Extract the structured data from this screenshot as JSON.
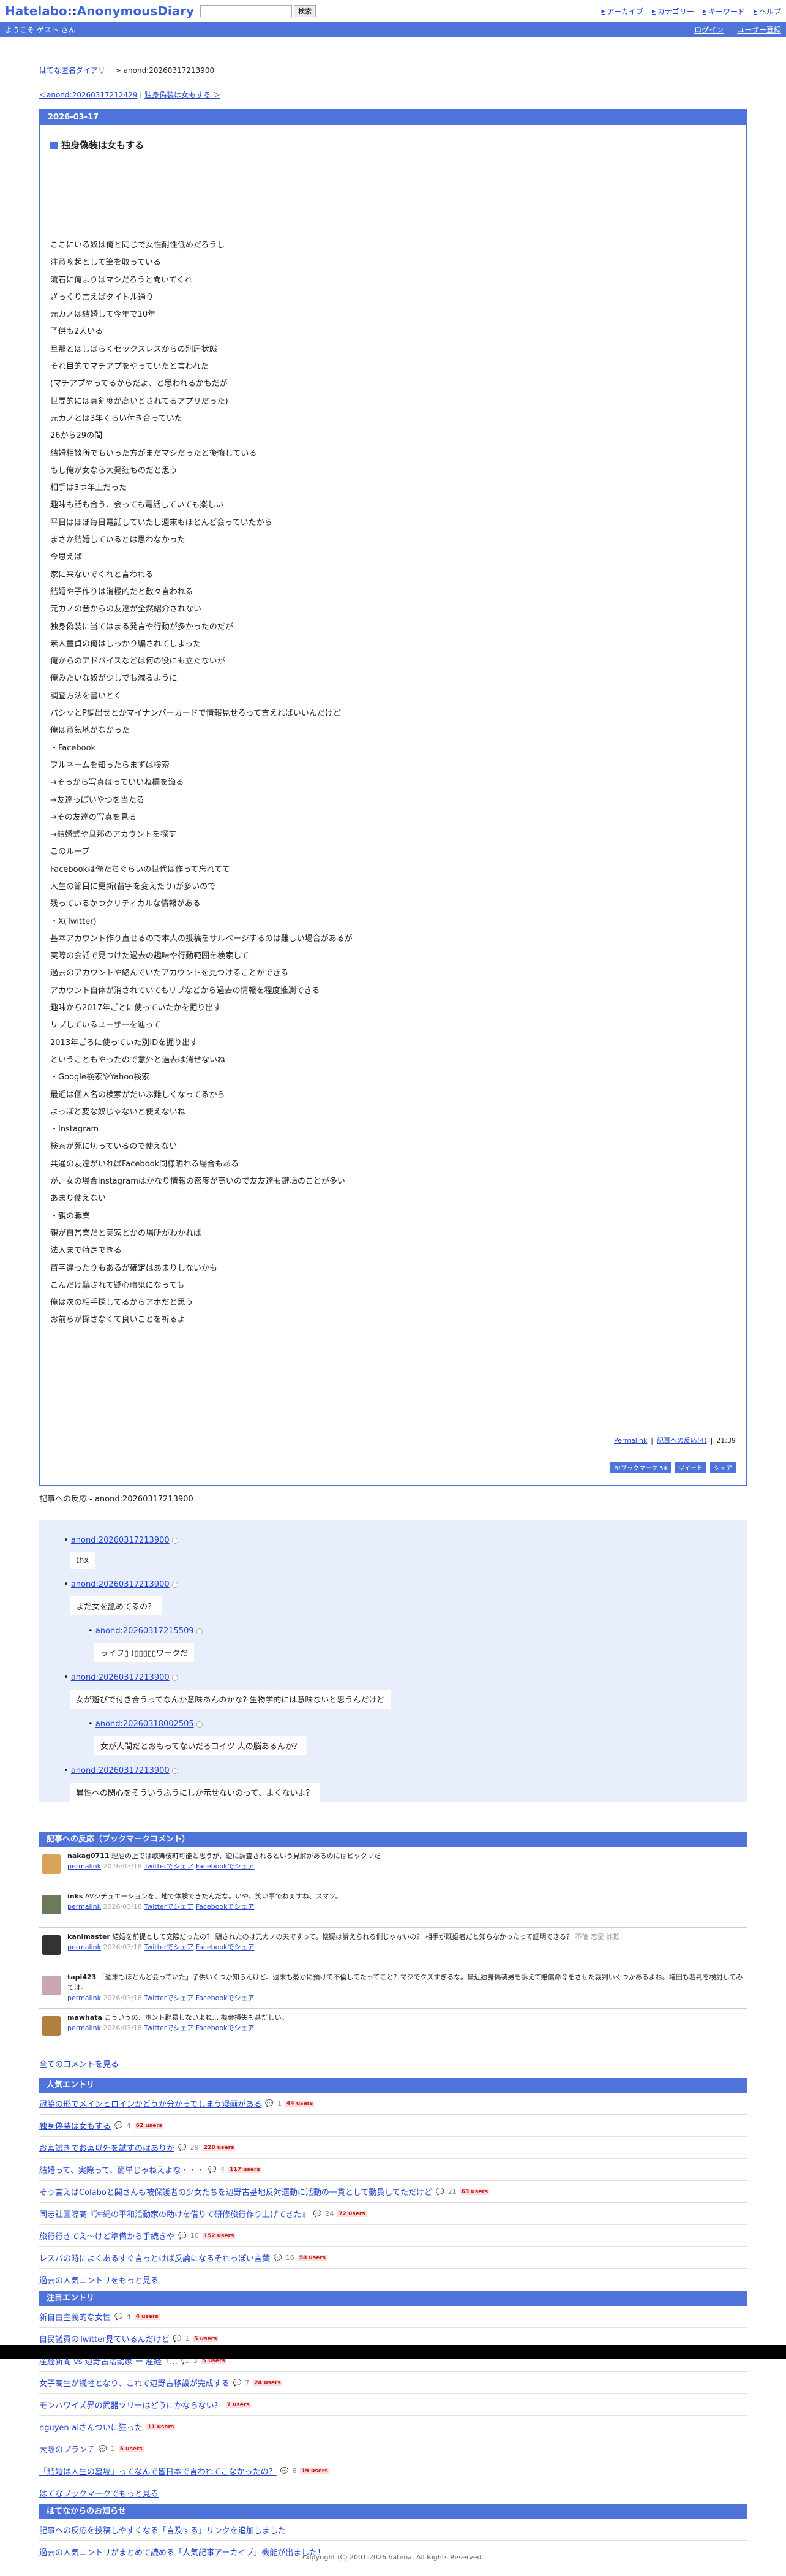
{
  "header": {
    "logo_left": "Hatelabo",
    "logo_sep": "::",
    "logo_right": "AnonymousDiary",
    "search_button": "検索",
    "nav": [
      "アーカイブ",
      "カテゴリー",
      "キーワード",
      "ヘルプ"
    ]
  },
  "bar": {
    "welcome": "ようこそ ゲスト さん",
    "login": "ログイン",
    "register": "ユーザー登録"
  },
  "crumb": {
    "home": "はてな匿名ダイアリー",
    "sep": " > ",
    "current": "anond:20260317213900"
  },
  "prevnext": {
    "prev": "＜anond:20260317212429",
    "sep": " | ",
    "next": "独身偽装は女もする ＞"
  },
  "article": {
    "date": "2026-03-17",
    "title": "独身偽装は女もする",
    "lines": [
      "ここにいる奴は俺と同じで女性耐性低めだろうし",
      "注意喚起として筆を取っている",
      "流石に俺よりはマシだろうと聞いてくれ",
      "ざっくり言えばタイトル通り",
      "元カノは結婚して今年で10年",
      "子供も2人いる",
      "旦那とはしばらくセックスレスからの別居状態",
      "それ目的でマチアプをやっていたと言われた",
      "(マチアプやってるからだよ、と思われるかもだが",
      "世間的には真剣度が高いとされてるアプリだった)",
      "元カノとは3年くらい付き合っていた",
      "26から29の間",
      "結婚相談所でもいった方がまだマシだったと後悔している",
      "もし俺が女なら大発狂ものだと思う",
      "相手は3つ年上だった",
      "趣味も話も合う、会っても電話していても楽しい",
      "平日はほぼ毎日電話していたし週末もほとんど会っていたから",
      "まさか結婚しているとは思わなかった",
      "今思えば",
      "家に来ないでくれと言われる",
      "結婚や子作りは消極的だと散々言われる",
      "元カノの昔からの友達が全然紹介されない",
      "独身偽装に当てはまる発言や行動が多かったのだが",
      "素人童貞の俺はしっかり騙されてしまった",
      "俺からのアドバイスなどは何の役にも立たないが",
      "俺みたいな奴が少しでも減るように",
      "調査方法を書いとく",
      "パシッとP調出せとかマイナンバーカードで情報見せろって言えればいいんだけど",
      "俺は意気地がなかった",
      "・Facebook",
      "フルネームを知ったらまずは検索",
      "→そっから写真はっていいね欄を漁る",
      "→友達っぽいやつを当たる",
      "→その友達の写真を見る",
      "→結婚式や旦那のアカウントを探す",
      "このループ",
      "Facebookは俺たちぐらいの世代は作って忘れてて",
      "人生の節目に更新(苗字を変えたり)が多いので",
      "残っているかつクリティカルな情報がある",
      "・X(Twitter)",
      "基本アカウント作り直せるので本人の投稿をサルベージするのは難しい場合があるが",
      "実際の会話で見つけた過去の趣味や行動範囲を検索して",
      "過去のアカウントや絡んでいたアカウントを見つけることができる",
      "アカウント自体が消されていてもリプなどから過去の情報を程度推測できる",
      "趣味から2017年ごとに使っていたかを掘り出す",
      "リプしているユーザーを辿って",
      "2013年ごろに使っていた別IDを掘り出す",
      "ということもやったので意外と過去は消せないね",
      "・Google検索やYahoo検索",
      "最近は個人名の検索がだいぶ難しくなってるから",
      "よっぽど変な奴じゃないと使えないね",
      "・Instagram",
      "検索が死に切っているので使えない",
      "共通の友達がいればFacebook同様晒れる場合もある",
      "が、女の場合Instagramはかなり情報の密度が高いので友友達も鍵垢のことが多い",
      "あまり使えない",
      "・親の職業",
      "親が自営業だと実家とかの場所がわかれば",
      "法人まで特定できる",
      "苗字違ったりもあるが確定はあまりしないかも",
      "こんだけ騙されて疑心暗鬼になっても",
      "俺は次の相手探してるからアホだと思う",
      "お前らが探さなくて良いことを祈るよ"
    ],
    "permalink": "Permalink",
    "reaction_link": "記事への反応(4)",
    "time": "21:39",
    "share": [
      "B!ブックマーク 54",
      "ツイート",
      "シェア"
    ]
  },
  "reactions": {
    "title": "記事への反応 - anond:20260317213900",
    "items": [
      {
        "link": "anond:20260317213900",
        "text": "thx",
        "children": []
      },
      {
        "link": "anond:20260317213900",
        "text": "まだ女を舐めてるの？",
        "children": [
          {
            "link": "anond:20260317215509",
            "text": "ライフ▯ (▯▯▯▯▯ワークだ"
          }
        ]
      },
      {
        "link": "anond:20260317213900",
        "text": "女が遊びで付き合うってなんか意味あんのかな? 生物学的には意味ないと思うんだけど",
        "children": [
          {
            "link": "anond:20260318002505",
            "text": "女が人間だとおもってないだろコイツ 人の脳あるんか？"
          }
        ]
      },
      {
        "link": "anond:20260317213900",
        "text": "異性への関心をそういうふうにしか示せないのって、よくないよ？",
        "children": []
      }
    ]
  },
  "bookmarks": {
    "title": "記事への反応（ブックマークコメント）",
    "items": [
      {
        "user": "nakag0711",
        "comment": "理屈の上では歌舞伎町可能と思うが、逆に調査されるという見解があるのにはビックリだ",
        "date": "2026/03/18",
        "av": "#d9a35a"
      },
      {
        "user": "inks",
        "comment": "AVシチュエーションを、地で体験できたんだな。いや、笑い事でねぇすね、スマソ。",
        "date": "2026/03/18",
        "av": "#6a7a5a"
      },
      {
        "user": "kanimaster",
        "comment": "結婚を前提として交際だったの？ 騙されたのは元カノの夫ですって。懐疑は訴えられる側じゃないの？ 相手が既婚者だと知らなかったって証明できる？",
        "tags": "不倫 恋愛 詐欺",
        "date": "2026/03/18",
        "av": "#333"
      },
      {
        "user": "tapi423",
        "comment": "「週末もほとんど会っていた」子供いくつか知らんけど、週末も蒸かに預けて不倫してたってこと？マジでクズすぎるな。最近独身偽装男を訴えて賠償命令をさせた裁判いくつかあるよね。増田も裁判を検討してみては。",
        "date": "2026/03/18",
        "av": "#c9a6b2"
      },
      {
        "user": "mawhata",
        "comment": "こういうの、ホント辟易しないよね… 機会損失も甚だしい。",
        "date": "2026/03/18",
        "av": "#b08040"
      }
    ],
    "permalink": "permalink",
    "twitter": "Twitterでシェア",
    "facebook": "Facebookでシェア",
    "all": "全てのコメントを見る"
  },
  "popular": {
    "title": "人気エントリ",
    "items": [
      {
        "t": "冠脇の形でメインヒロインかどうか分かってしまう漫画がある",
        "c": "1",
        "u": "44 users"
      },
      {
        "t": "独身偽装は女もする",
        "c": "4",
        "u": "62 users"
      },
      {
        "t": "お宮試きでお宮以外を試すのはありか",
        "c": "29",
        "u": "228 users"
      },
      {
        "t": "結婚って、実際って、簡単じゃねえよな・・・",
        "c": "4",
        "u": "117 users"
      },
      {
        "t": "そう言えばColaboと関さんも被保護者の少女たちを辺野古基地反対運動に活動の一貫として動員してただけど",
        "c": "21",
        "u": "63 users"
      },
      {
        "t": "同志社国際高『沖縄の平和活動家の助けを借りて研修旅行作り上げてきた』",
        "c": "24",
        "u": "72 users"
      },
      {
        "t": "旅行行きてえ〜けど準備から手続きや",
        "c": "10",
        "u": "152 users"
      },
      {
        "t": "レスバの時によくあるすぐ言っとけば反論になるそれっぽい言葉",
        "c": "16",
        "u": "58 users"
      }
    ],
    "more": "過去の人気エントリをもっと見る"
  },
  "hot": {
    "title": "注目エントリ",
    "items": [
      {
        "t": "新自由主義的な女性",
        "c": "4",
        "u": "4 users"
      },
      {
        "t": "自民議員のTwitter見ているんだけど",
        "c": "1",
        "u": "5 users"
      },
      {
        "t": "産経新聞 vs 辺野古活動家 ー 産経「…",
        "c": "3",
        "u": "5 users"
      },
      {
        "t": "女子高生が犠牲となり、これで辺野古移設が完成する",
        "c": "7",
        "u": "24 users"
      },
      {
        "t": "モンハワイズ界の武器ツリーはどうにかならない？",
        "c": "",
        "u": "7 users"
      },
      {
        "t": "nguyen-aiさんついに狂った",
        "c": "",
        "u": "11 users"
      },
      {
        "t": "大阪のプランチ",
        "c": "1",
        "u": "5 users"
      },
      {
        "t": "「結婚は人生の墓場」ってなんで皆日本で言われてこなかったの？",
        "c": "6",
        "u": "19 users"
      }
    ],
    "more": "はてなブックマークでもっと見る"
  },
  "notice": {
    "title": "はてなからのお知らせ",
    "items": [
      "記事への反応を投稿しやすくなる「言及する」リンクを追加しました",
      "過去の人気エントリがまとめて読める「人気記事アーカイブ」機能が出ました！"
    ]
  },
  "footer": {
    "copyright": "Copyright (C) 2001-2026 hatena. All Rights Reserved."
  }
}
